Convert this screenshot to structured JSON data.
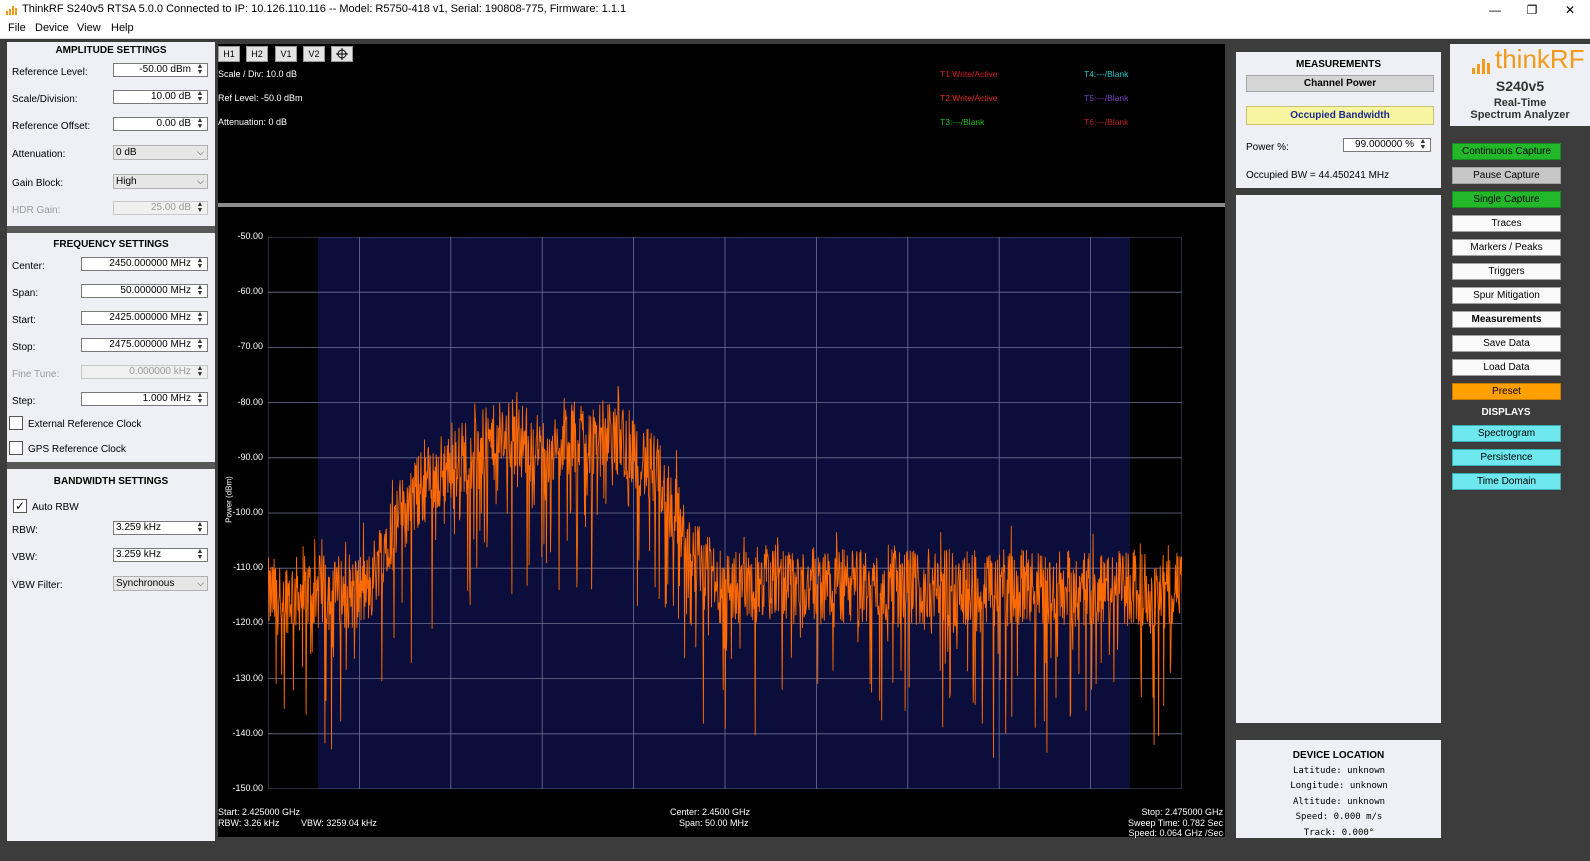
{
  "window": {
    "title": "ThinkRF S240v5 RTSA 5.0.0 Connected to IP: 10.126.110.116 -- Model: R5750-418 v1, Serial: 190808-775, Firmware: 1.1.1",
    "minimize": "—",
    "maximize": "❐",
    "close": "✕"
  },
  "menu": [
    "File",
    "Device",
    "View",
    "Help"
  ],
  "amplitude": {
    "title": "AMPLITUDE SETTINGS",
    "reference_level": {
      "label": "Reference Level:",
      "value": "-50.00 dBm"
    },
    "scale_division": {
      "label": "Scale/Division:",
      "value": "10.00 dB"
    },
    "reference_offset": {
      "label": "Reference Offset:",
      "value": "0.00 dB"
    },
    "attenuation": {
      "label": "Attenuation:",
      "value": "0 dB"
    },
    "gain_block": {
      "label": "Gain Block:",
      "value": "High"
    },
    "hdr_gain": {
      "label": "HDR Gain:",
      "value": "25.00 dB"
    }
  },
  "frequency": {
    "title": "FREQUENCY SETTINGS",
    "center": {
      "label": "Center:",
      "value": "2450.000000 MHz"
    },
    "span": {
      "label": "Span:",
      "value": "50.000000 MHz"
    },
    "start": {
      "label": "Start:",
      "value": "2425.000000 MHz"
    },
    "stop": {
      "label": "Stop:",
      "value": "2475.000000 MHz"
    },
    "fine_tune": {
      "label": "Fine Tune:",
      "value": "0.000000 kHz"
    },
    "step": {
      "label": "Step:",
      "value": "1.000 MHz"
    },
    "ext_ref": {
      "label": "External Reference Clock",
      "checked": false
    },
    "gps_ref": {
      "label": "GPS Reference Clock",
      "checked": false
    }
  },
  "bandwidth": {
    "title": "BANDWIDTH SETTINGS",
    "auto_rbw": {
      "label": "Auto RBW",
      "checked": true
    },
    "rbw": {
      "label": "RBW:",
      "value": "3.259 kHz"
    },
    "vbw": {
      "label": "VBW:",
      "value": "3.259 kHz"
    },
    "vbw_filter": {
      "label": "VBW Filter:",
      "value": "Synchronous"
    }
  },
  "graph_buttons": [
    "H1",
    "H2",
    "V1",
    "V2"
  ],
  "graph_info": {
    "scale": "Scale / Div: 10.0 dB",
    "ref_level": "Ref Level: -50.0 dBm",
    "attenuation": "Attenuation: 0 dB"
  },
  "traces": [
    {
      "label": "T1:Write/Active",
      "color": "#d02020"
    },
    {
      "label": "T2:Write/Active",
      "color": "#e03020"
    },
    {
      "label": "T3:---/Blank",
      "color": "#20c020"
    },
    {
      "label": "T4:---/Blank",
      "color": "#20c8c8"
    },
    {
      "label": "T5:---/Blank",
      "color": "#7a40c0"
    },
    {
      "label": "T6:---/Blank",
      "color": "#c02020"
    }
  ],
  "plot": {
    "ylabel": "Power (dBm)",
    "trace_color": "#ff6a00",
    "grid_bg": "#0b0e3a",
    "footer": {
      "start": "Start: 2.425000 GHz",
      "rbw": "RBW: 3.26 kHz",
      "vbw": "VBW: 3259.04 kHz",
      "center": "Center: 2.4500 GHz",
      "span": "Span: 50.00 MHz",
      "stop": "Stop: 2.475000 GHz",
      "sweep": "Sweep Time: 0.782 Sec",
      "speed": "Speed: 0.064 GHz /Sec"
    }
  },
  "chart_data": {
    "type": "line",
    "ylabel": "Power (dBm)",
    "x_start": 2.425,
    "x_stop": 2.475,
    "x_unit": "GHz",
    "ylim": [
      -150,
      -50
    ],
    "yticks": [
      "-50.00",
      "-60.00",
      "-70.00",
      "-80.00",
      "-90.00",
      "-100.00",
      "-110.00",
      "-120.00",
      "-130.00",
      "-140.00",
      "-150.00"
    ],
    "grid": true,
    "series": [
      {
        "color": "#ff6a00",
        "envelope": [
          {
            "x": 2.425,
            "y": -115
          },
          {
            "x": 2.4305,
            "y": -114
          },
          {
            "x": 2.4315,
            "y": -104
          },
          {
            "x": 2.4335,
            "y": -95
          },
          {
            "x": 2.436,
            "y": -89
          },
          {
            "x": 2.4385,
            "y": -86
          },
          {
            "x": 2.4405,
            "y": -90
          },
          {
            "x": 2.442,
            "y": -86
          },
          {
            "x": 2.4445,
            "y": -87
          },
          {
            "x": 2.4465,
            "y": -94
          },
          {
            "x": 2.448,
            "y": -106
          },
          {
            "x": 2.4495,
            "y": -113
          },
          {
            "x": 2.475,
            "y": -114
          }
        ]
      }
    ]
  },
  "measurements": {
    "title": "MEASUREMENTS",
    "channel_power": "Channel Power",
    "occupied_bandwidth": "Occupied Bandwidth",
    "power_pct_label": "Power %:",
    "power_pct_value": "99.000000 %",
    "occupied_bw": "Occupied BW = 44.450241 MHz"
  },
  "location": {
    "title": "DEVICE LOCATION",
    "latitude": "Latitude: unknown",
    "longitude": "Longitude: unknown",
    "altitude": "Altitude: unknown",
    "speed": "Speed: 0.000 m/s",
    "track": "Track: 0.000°"
  },
  "brand": {
    "name": "thinkRF",
    "model": "S240v5",
    "subtitle1": "Real-Time",
    "subtitle2": "Spectrum Analyzer"
  },
  "right_buttons": {
    "continuous": "Continuous Capture",
    "pause": "Pause Capture",
    "single": "Single Capture",
    "traces": "Traces",
    "markers": "Markers / Peaks",
    "triggers": "Triggers",
    "spur": "Spur Mitigation",
    "measurements": "Measurements",
    "save": "Save Data",
    "load": "Load Data",
    "preset": "Preset",
    "displays_title": "DISPLAYS",
    "spectrogram": "Spectrogram",
    "persistence": "Persistence",
    "time_domain": "Time Domain"
  },
  "colors": {
    "green": "#22b82a",
    "gray": "#c6c6c6",
    "orange": "#ffa000",
    "cyan": "#6ee8ee",
    "highlight_yellow": "#f8f5a0"
  }
}
